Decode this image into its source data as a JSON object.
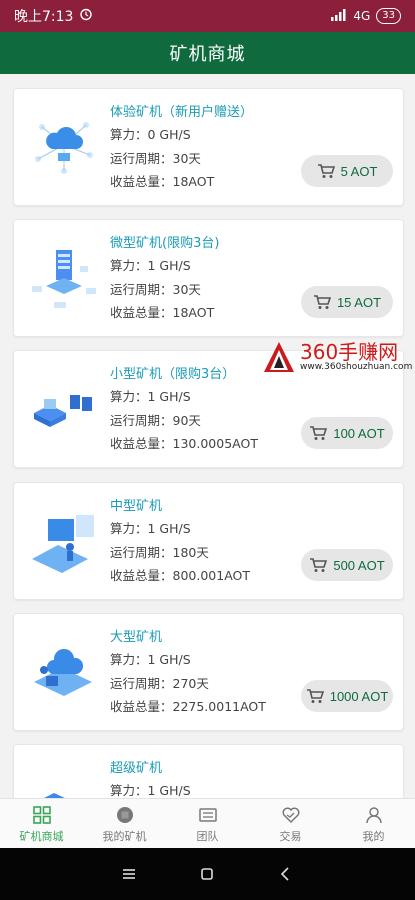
{
  "status_bar": {
    "time": "晚上7:13",
    "network": "4G",
    "battery": "33"
  },
  "header": {
    "title": "矿机商城"
  },
  "cards": [
    {
      "title": "体验矿机（新用户赠送）",
      "power": "算力：0 GH/S",
      "period": "运行周期：30天",
      "income": "收益总量：18AOT",
      "price": "5 AOT"
    },
    {
      "title": "微型矿机(限购3台)",
      "power": "算力：1 GH/S",
      "period": "运行周期：30天",
      "income": "收益总量：18AOT",
      "price": "15 AOT"
    },
    {
      "title": "小型矿机（限购3台）",
      "power": "算力：1 GH/S",
      "period": "运行周期：90天",
      "income": "收益总量：130.0005AOT",
      "price": "100 AOT"
    },
    {
      "title": "中型矿机",
      "power": "算力：1 GH/S",
      "period": "运行周期：180天",
      "income": "收益总量：800.001AOT",
      "price": "500 AOT"
    },
    {
      "title": "大型矿机",
      "power": "算力：1 GH/S",
      "period": "运行周期：270天",
      "income": "收益总量：2275.0011AOT",
      "price": "1000 AOT"
    },
    {
      "title": "超级矿机",
      "power": "算力：1 GH/S",
      "period": "",
      "income": "",
      "price": ""
    }
  ],
  "watermark": {
    "text": "360手赚网",
    "url": "www.360shouzhuan.com"
  },
  "tabs": [
    {
      "label": "矿机商城",
      "icon": "grid-icon"
    },
    {
      "label": "我的矿机",
      "icon": "miner-icon"
    },
    {
      "label": "团队",
      "icon": "team-icon"
    },
    {
      "label": "交易",
      "icon": "handshake-icon"
    },
    {
      "label": "我的",
      "icon": "user-icon"
    }
  ],
  "colors": {
    "header": "#0f6b3e",
    "status_bar": "#8c1f3a",
    "title_accent": "#1a9bb8",
    "active_tab": "#3aa655"
  }
}
